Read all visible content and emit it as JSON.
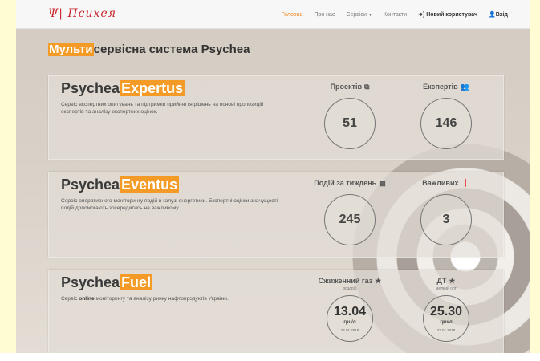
{
  "nav": {
    "logo": "Ψ| Психея",
    "links": [
      "Головна",
      "Про нас",
      "Сервіси",
      "Контакти",
      "Новий користувач",
      "Вхід"
    ]
  },
  "main_title": {
    "highlight": "Мульти",
    "rest": "сервісна система Psychea"
  },
  "panels": [
    {
      "title_prefix": "Psychea",
      "title_highlight": "Expertus",
      "description": "Сервіс експертних опитувань та підтримки прийняття рішень на основі пропозицій експертів та аналізу експертних оцінок.",
      "stats": [
        {
          "label": "Проектів",
          "value": "51"
        },
        {
          "label": "Експертів",
          "value": "146"
        }
      ]
    },
    {
      "title_prefix": "Psychea",
      "title_highlight": "Eventus",
      "description": "Сервіс оперативного моніторингу подій в галузі енергетики. Експертні оцінки значущості подій допомогають зосередитись на важливому.",
      "stats": [
        {
          "label": "Подій за тиждень",
          "value": "245"
        },
        {
          "label": "Важливих",
          "value": "3"
        }
      ]
    },
    {
      "title_prefix": "Psychea",
      "title_highlight": "Fuel",
      "description_pre": "Сервіс ",
      "description_bold": "online",
      "description_post": " моніторингу та аналізу ринку нафтопродуктів України.",
      "stats": [
        {
          "label": "Сжиженний газ",
          "sub": "роздріб",
          "value": "13.04",
          "unit": "грн/л",
          "date": "22.01.2018"
        },
        {
          "label": "ДТ",
          "sub": "мелкий опт",
          "value": "25.30",
          "unit": "грн/л",
          "date": "22.01.2018"
        }
      ]
    }
  ],
  "colors": {
    "accent": "#f39b26",
    "nav_active": "#f0861f",
    "logo": "#c8242b"
  },
  "icons": {
    "projects": "sitemap-icon",
    "experts": "users-icon",
    "events": "calendar-icon",
    "important": "exclamation-circle-icon",
    "lpg": "star-icon",
    "diesel": "star-icon",
    "new_user": "sign-in-icon",
    "login": "user-icon"
  }
}
